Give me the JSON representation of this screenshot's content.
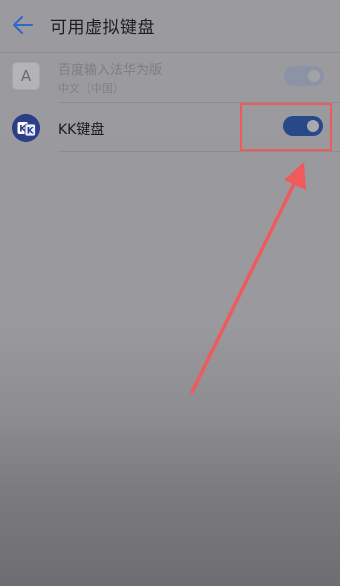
{
  "header": {
    "back_icon": "arrow-left-icon",
    "title": "可用虚拟键盘"
  },
  "keyboards": [
    {
      "name": "百度输入法华为版",
      "subtitle": "中文（中国）",
      "icon": "A",
      "enabled": true,
      "disabled_appearance": true
    },
    {
      "name": "KK键盘",
      "icon": "KK",
      "enabled": true
    }
  ],
  "annotation": {
    "color": "#f15a5c",
    "highlight": "kk-keyboard-toggle",
    "arrow": "pointing-up-to-toggle"
  }
}
